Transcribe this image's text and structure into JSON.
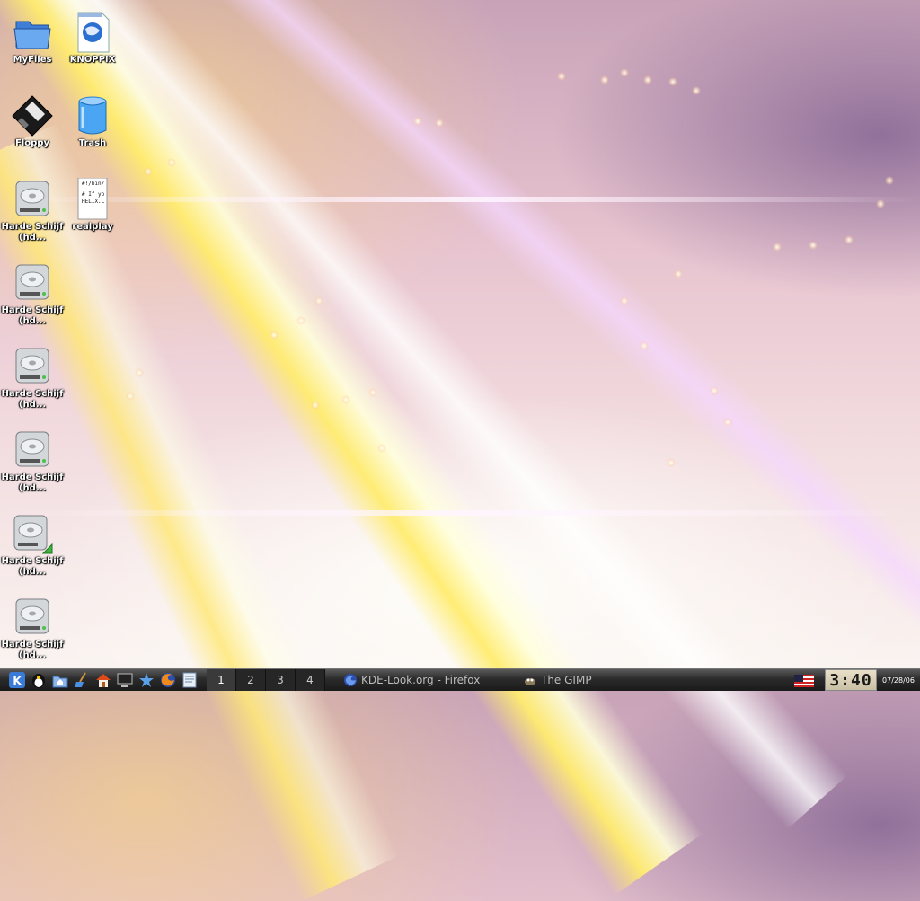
{
  "desktop": {
    "icons": [
      {
        "label": "MyFiles",
        "icon": "folder-icon"
      },
      {
        "label": "KNOPPIX",
        "icon": "html-document-icon"
      },
      {
        "label": "Floppy",
        "icon": "floppy-icon"
      },
      {
        "label": "Trash",
        "icon": "trash-icon"
      },
      {
        "label": "Harde Schijf (hd...",
        "icon": "hard-disk-icon"
      },
      {
        "label": "realplay",
        "icon": "script-file-icon"
      },
      {
        "label": "Harde Schijf (hd...",
        "icon": "hard-disk-icon"
      },
      {
        "label": "Harde Schijf (hd...",
        "icon": "hard-disk-icon"
      },
      {
        "label": "Harde Schijf (hd...",
        "icon": "hard-disk-icon"
      },
      {
        "label": "Harde Schijf (hd...",
        "icon": "hard-disk-mounted-icon"
      },
      {
        "label": "Harde Schijf (hd...",
        "icon": "hard-disk-icon"
      }
    ],
    "realplay_preview": {
      "line1": "#!/bin/",
      "line2": "# If yo",
      "line3": "HELIX.L"
    }
  },
  "taskbar": {
    "quick_launch": [
      "kde-menu-icon",
      "knoppix-penguin-icon",
      "home-folder-icon",
      "cleaner-icon",
      "house-icon",
      "terminal-icon",
      "konqueror-icon",
      "firefox-icon",
      "text-editor-icon"
    ],
    "desktops": [
      "1",
      "2",
      "3",
      "4"
    ],
    "active_desktop": "1",
    "tasks": [
      {
        "label": "KDE-Look.org - Firefox",
        "icon": "firefox-globe-icon"
      },
      {
        "label": "The GIMP",
        "icon": "gimp-icon"
      }
    ],
    "keyboard_layout": "US",
    "clock_time": "3:40",
    "clock_date": "07/28/06"
  }
}
